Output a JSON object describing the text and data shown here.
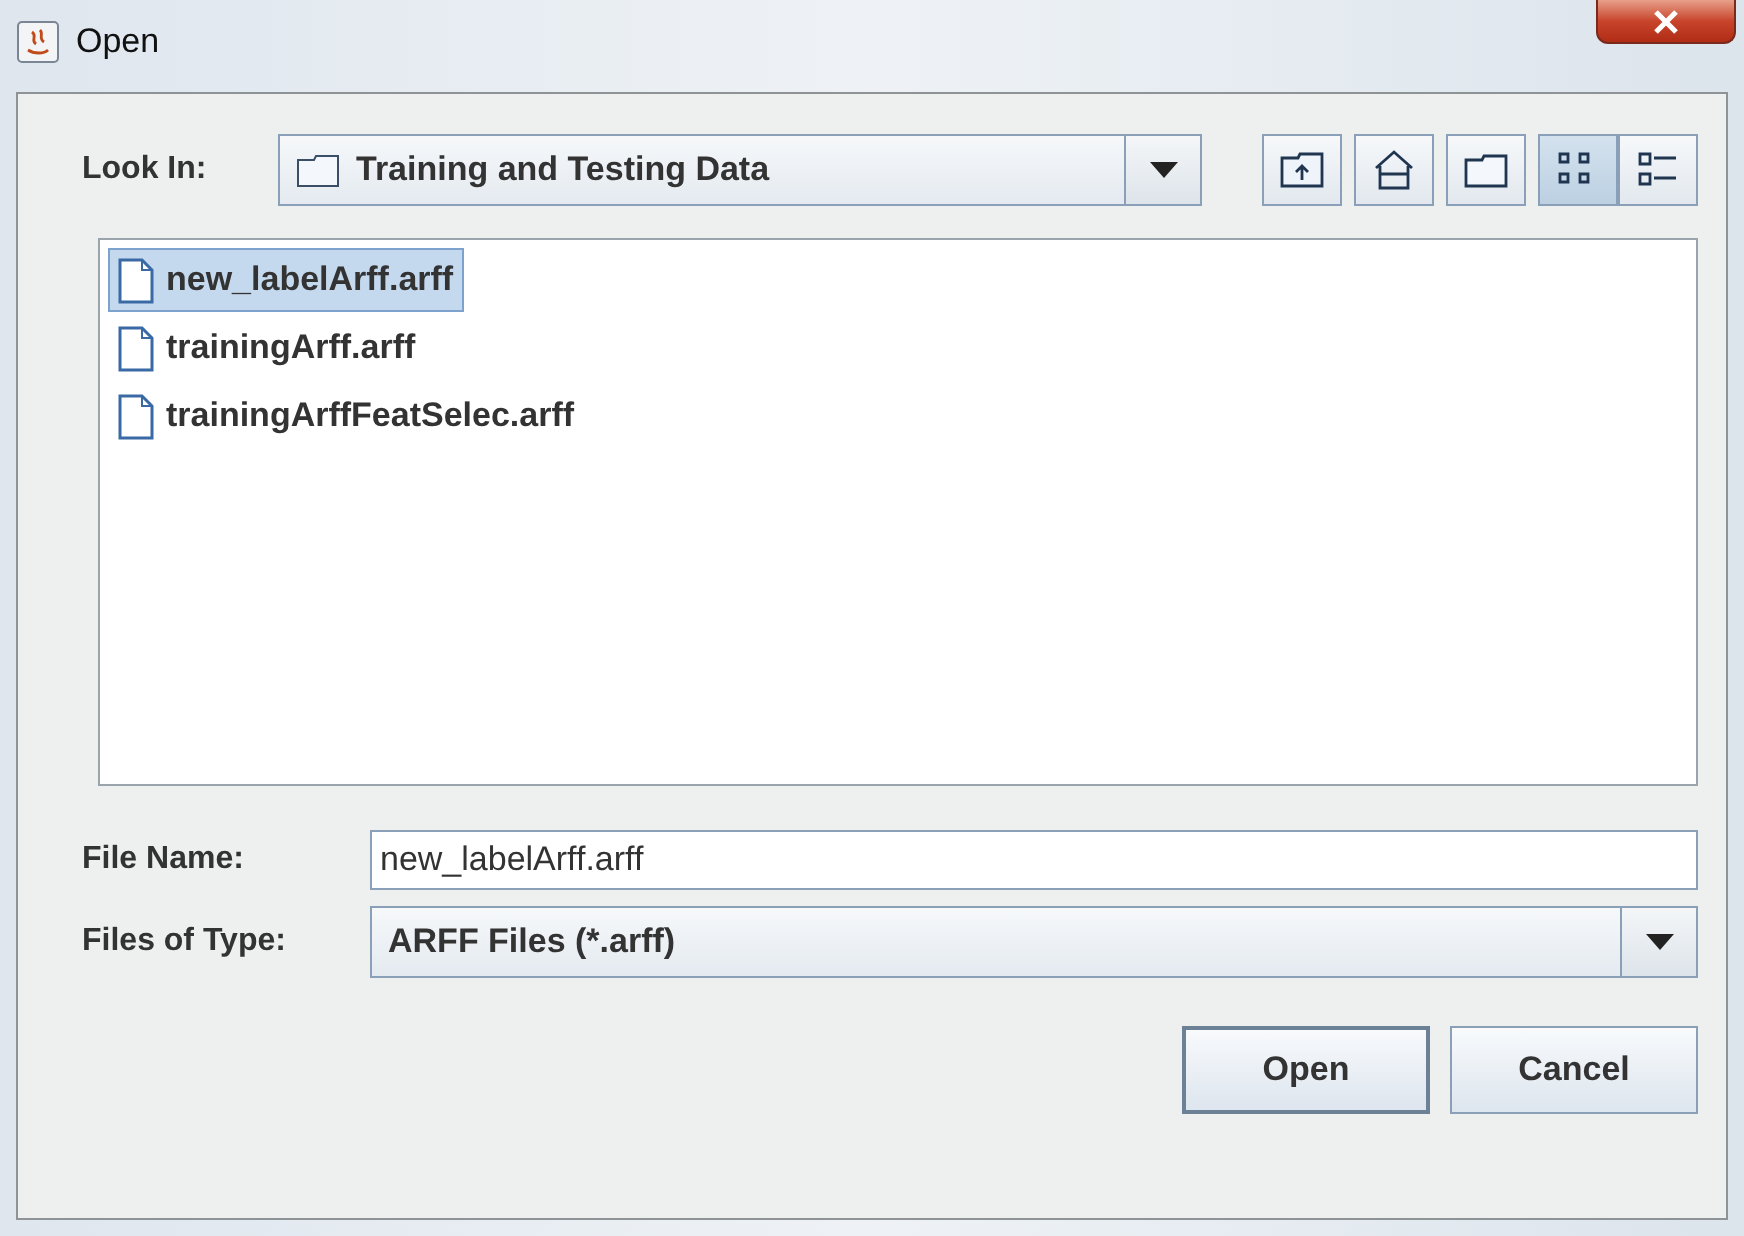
{
  "window": {
    "title": "Open"
  },
  "look_in": {
    "label": "Look In:",
    "value": "Training and Testing Data"
  },
  "toolbar": [
    {
      "kind": "up"
    },
    {
      "kind": "home"
    },
    {
      "kind": "new-folder"
    },
    {
      "kind": "list",
      "selected": true
    },
    {
      "kind": "details",
      "selected": false
    }
  ],
  "files": [
    {
      "name": "new_labelArff.arff",
      "selected": true
    },
    {
      "name": "trainingArff.arff",
      "selected": false
    },
    {
      "name": "trainingArffFeatSelec.arff",
      "selected": false
    }
  ],
  "file_name": {
    "label": "File Name:",
    "value": "new_labelArff.arff"
  },
  "file_type": {
    "label": "Files of Type:",
    "value": "ARFF Files (*.arff)"
  },
  "buttons": [
    "Open",
    "Cancel"
  ]
}
